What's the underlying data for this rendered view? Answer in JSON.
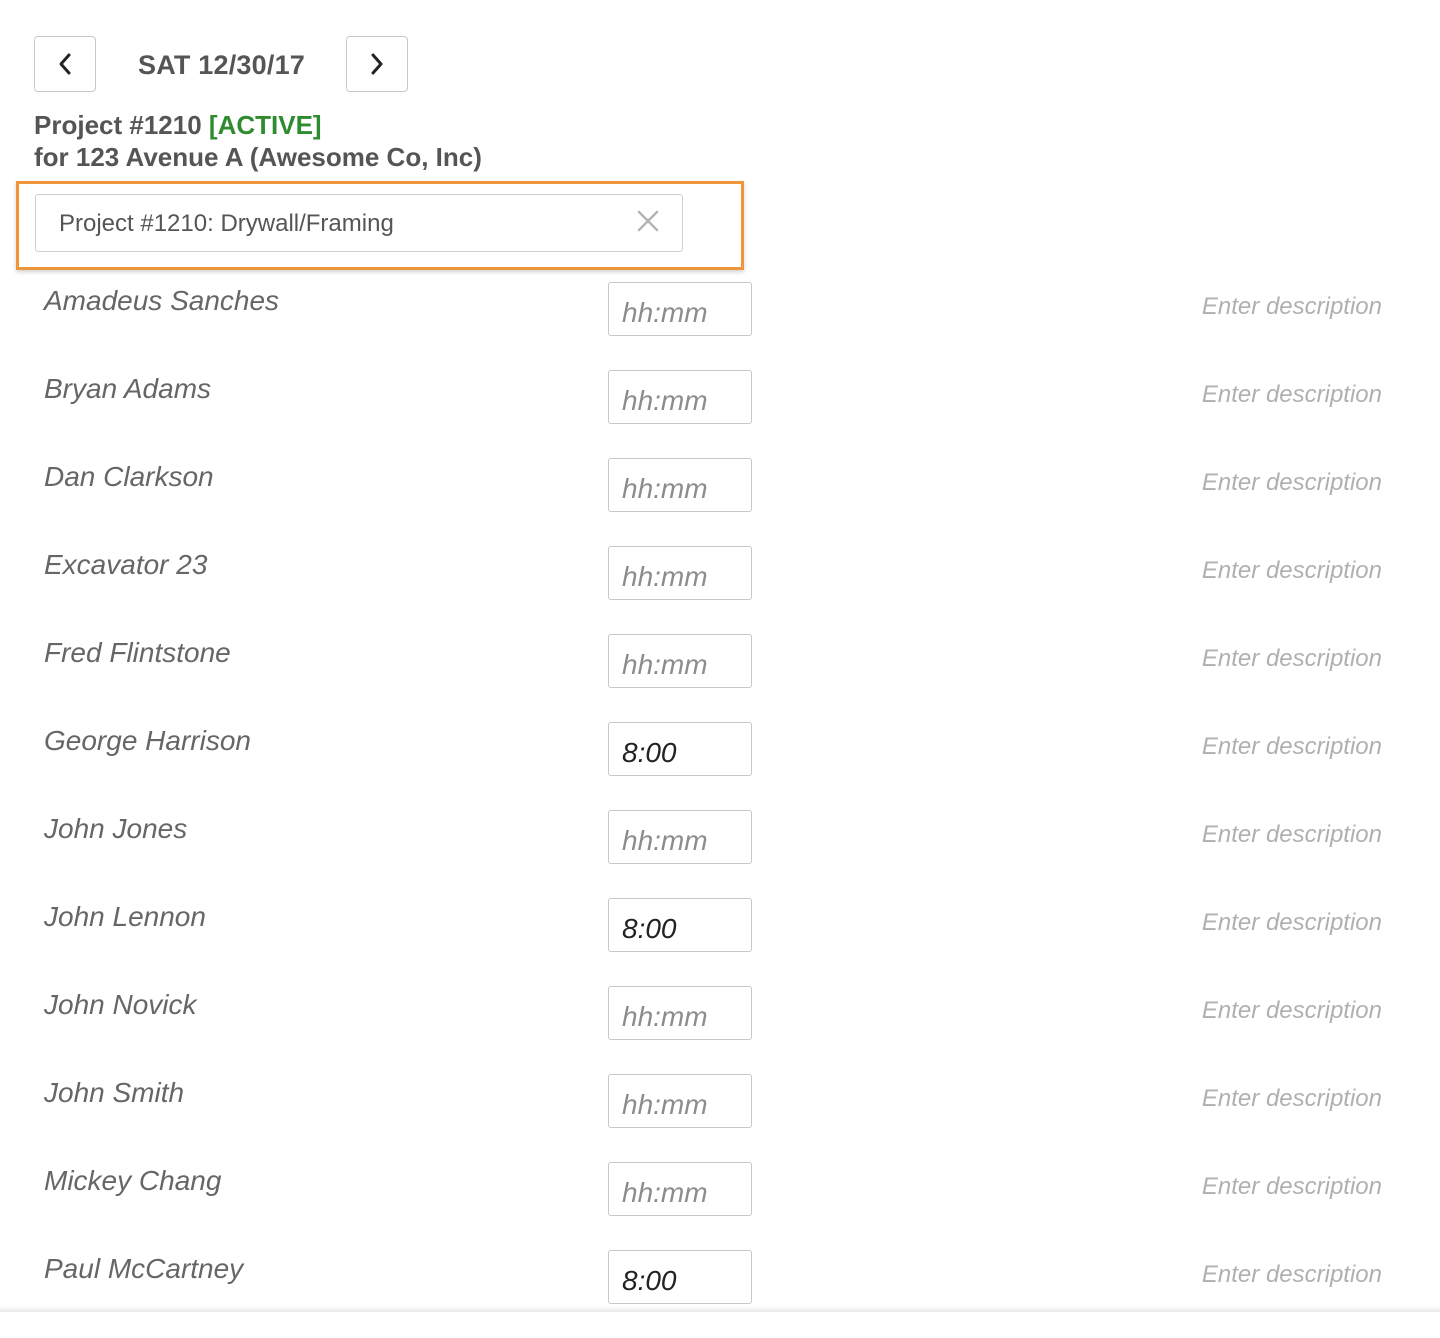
{
  "date_nav": {
    "prev_icon": "chevron-left-icon",
    "next_icon": "chevron-right-icon",
    "date": "SAT 12/30/17"
  },
  "project": {
    "title": "Project #1210",
    "status": "[ACTIVE]",
    "status_color": "#2e8b2e",
    "subtitle": "for 123 Avenue A (Awesome Co, Inc)"
  },
  "task_select": {
    "value": "Project #1210: Drywall/Framing",
    "clear_icon": "close-icon",
    "highlight_color": "#f0963a"
  },
  "placeholders": {
    "hours": "hh:mm",
    "description": "Enter description"
  },
  "workers": [
    {
      "name": "Amadeus Sanches",
      "hours": ""
    },
    {
      "name": "Bryan Adams",
      "hours": ""
    },
    {
      "name": "Dan Clarkson",
      "hours": ""
    },
    {
      "name": "Excavator 23",
      "hours": ""
    },
    {
      "name": "Fred Flintstone",
      "hours": ""
    },
    {
      "name": "George Harrison",
      "hours": "8:00"
    },
    {
      "name": "John Jones",
      "hours": ""
    },
    {
      "name": "John Lennon",
      "hours": "8:00"
    },
    {
      "name": "John Novick",
      "hours": ""
    },
    {
      "name": "John Smith",
      "hours": ""
    },
    {
      "name": "Mickey Chang",
      "hours": ""
    },
    {
      "name": "Paul McCartney",
      "hours": "8:00"
    }
  ]
}
